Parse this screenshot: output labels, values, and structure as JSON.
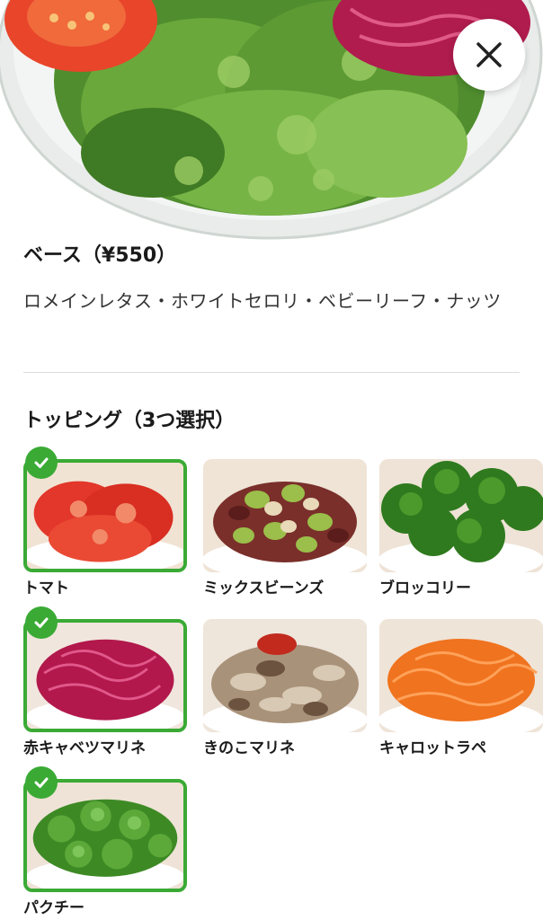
{
  "base": {
    "title": "ベース（¥550）",
    "description": "ロメインレタス・ホワイトセロリ・ベビーリーフ・ナッツ"
  },
  "toppings": {
    "title": "トッピング（3つ選択）",
    "items": [
      {
        "label": "トマト",
        "selected": true,
        "icon": "tomato-image"
      },
      {
        "label": "ミックスビーンズ",
        "selected": false,
        "icon": "mixed-beans-image"
      },
      {
        "label": "ブロッコリー",
        "selected": false,
        "icon": "broccoli-image"
      },
      {
        "label": "赤キャベツマリネ",
        "selected": true,
        "icon": "red-cabbage-image"
      },
      {
        "label": "きのこマリネ",
        "selected": false,
        "icon": "mushroom-image"
      },
      {
        "label": "キャロットラペ",
        "selected": false,
        "icon": "carrot-image"
      },
      {
        "label": "パクチー",
        "selected": true,
        "icon": "coriander-image"
      }
    ]
  },
  "colors": {
    "accent_green": "#3aaa35",
    "divider": "#dcdcdc"
  }
}
